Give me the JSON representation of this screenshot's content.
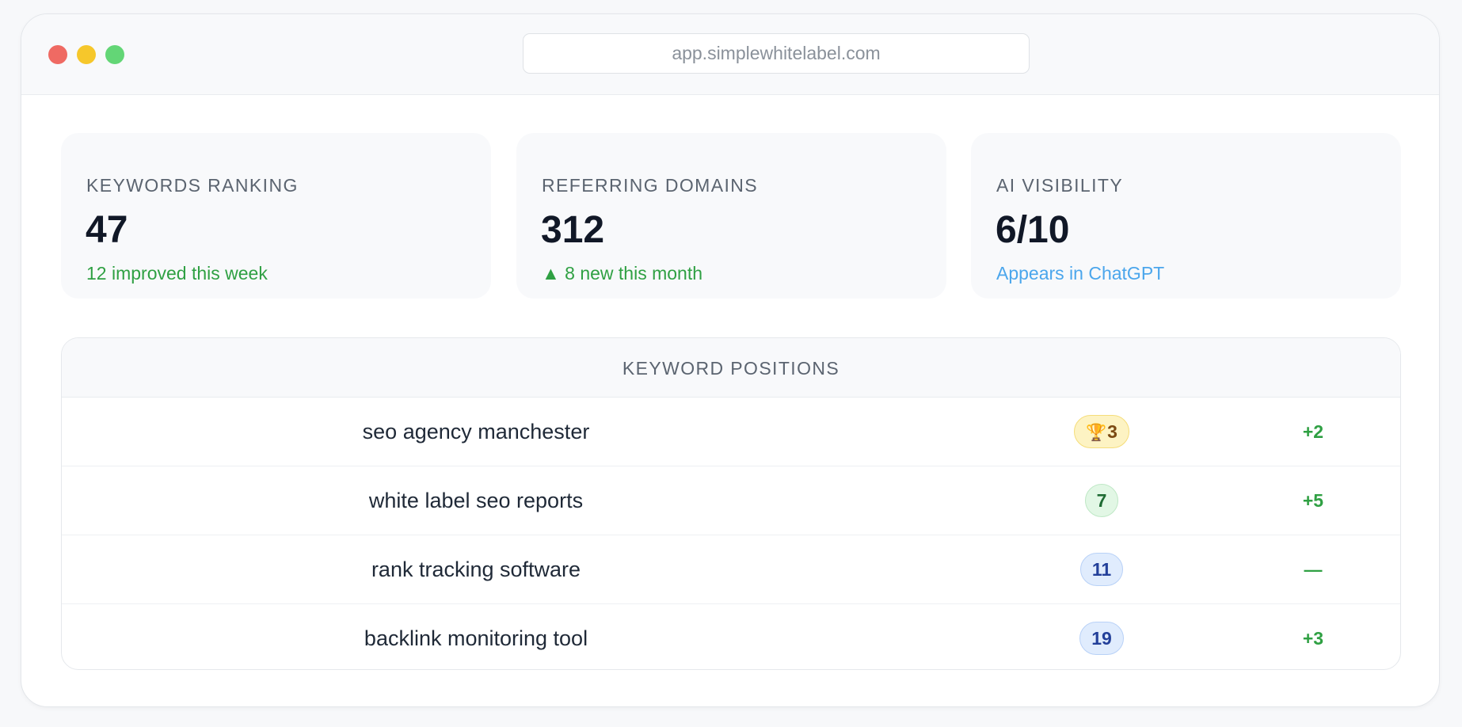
{
  "browser": {
    "url": "app.simplewhitelabel.com"
  },
  "stats": [
    {
      "label": "KEYWORDS RANKING",
      "value": "47",
      "sub": "12 improved this week",
      "sub_color": "#2fa043"
    },
    {
      "label": "REFERRING DOMAINS",
      "value": "312",
      "sub": "▲ 8 new this month",
      "sub_color": "#2fa043"
    },
    {
      "label": "AI VISIBILITY",
      "value": "6/10",
      "sub": "Appears in ChatGPT",
      "sub_color": "#4ba6ec"
    }
  ],
  "table": {
    "title": "KEYWORD POSITIONS",
    "rows": [
      {
        "keyword": "seo agency manchester",
        "position": "3",
        "position_icon": "trophy-icon",
        "badge_style": "gold",
        "change": "+2"
      },
      {
        "keyword": "white label seo reports",
        "position": "7",
        "badge_style": "green",
        "change": "+5"
      },
      {
        "keyword": "rank tracking software",
        "position": "11",
        "badge_style": "blue",
        "change": "—"
      },
      {
        "keyword": "backlink monitoring tool",
        "position": "19",
        "badge_style": "blue",
        "change": "+3"
      }
    ]
  },
  "colors": {
    "accent_green": "#2fa043",
    "accent_blue": "#4ba6ec",
    "dot_red": "#ef6a63",
    "dot_yellow": "#f6c72b",
    "dot_green": "#63d676"
  }
}
